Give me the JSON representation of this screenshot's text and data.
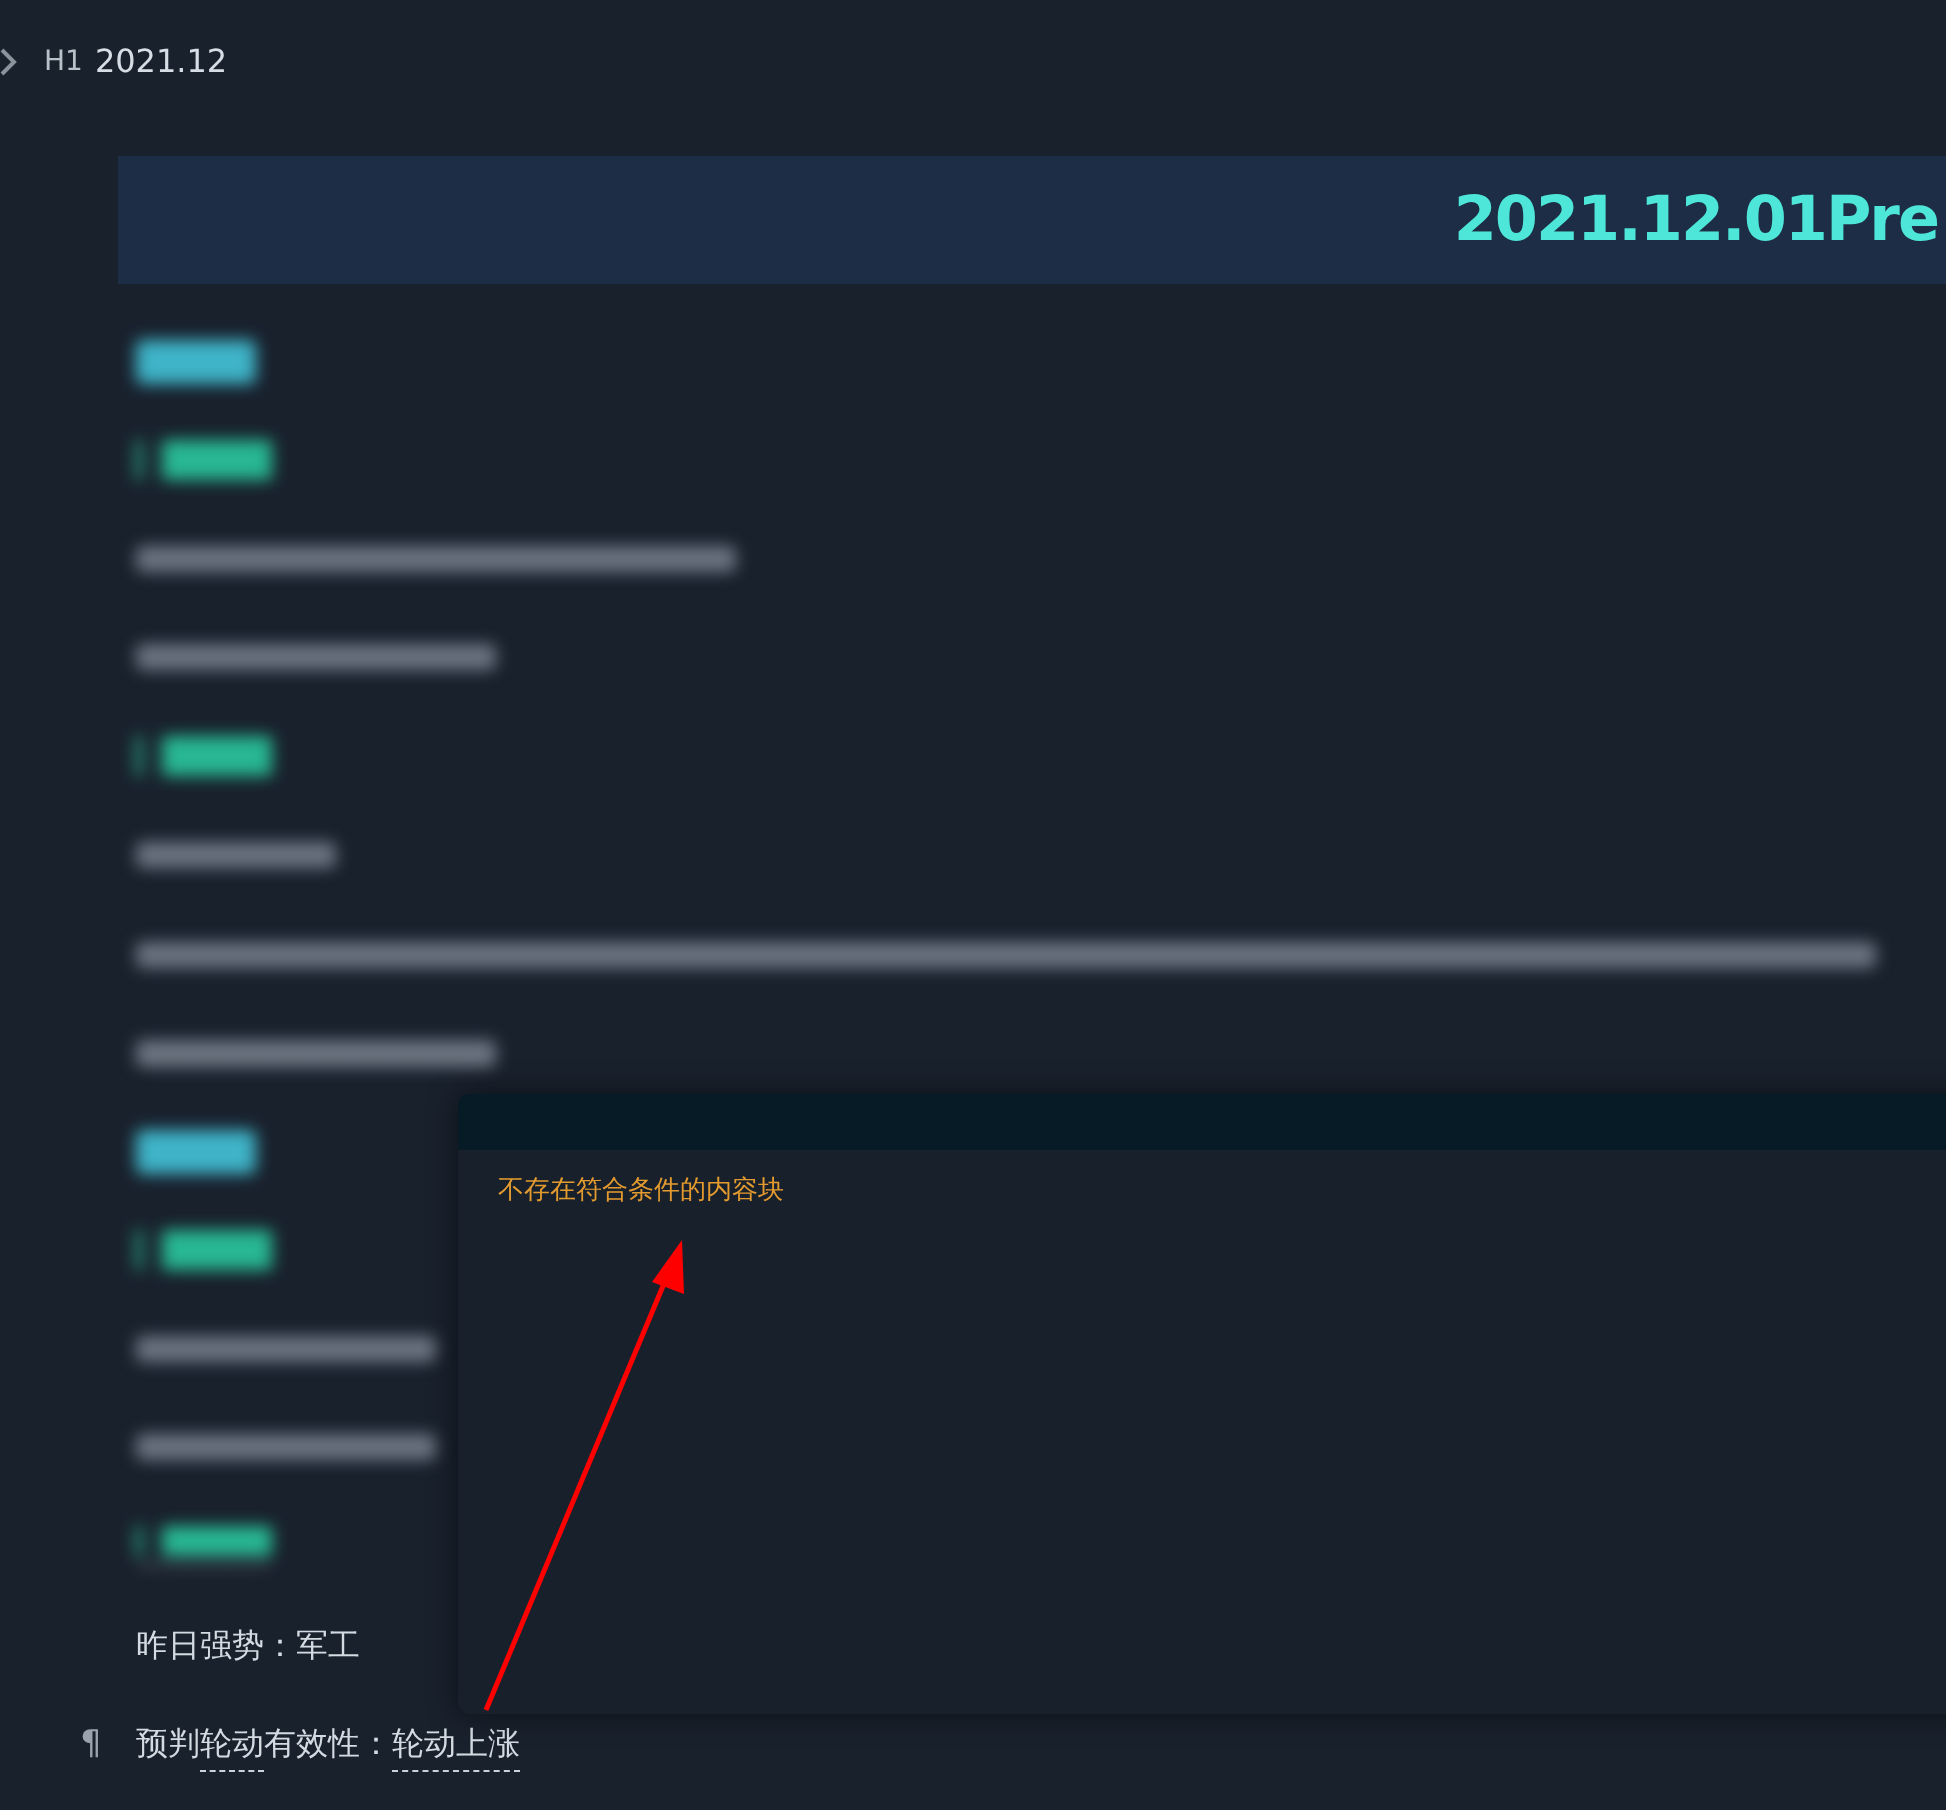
{
  "heading": {
    "marker": "H1",
    "title": "2021.12"
  },
  "banner": {
    "title": "2021.12.01Pre"
  },
  "blocks": [
    {
      "kind": "h2"
    },
    {
      "kind": "h3"
    },
    {
      "kind": "para"
    },
    {
      "kind": "para"
    },
    {
      "kind": "h3"
    },
    {
      "kind": "para"
    },
    {
      "kind": "para"
    },
    {
      "kind": "para-ref"
    },
    {
      "kind": "h2"
    },
    {
      "kind": "h3"
    },
    {
      "kind": "para-short"
    },
    {
      "kind": "para-short"
    },
    {
      "kind": "h3-ref"
    },
    {
      "kind": "text",
      "segments": [
        {
          "text": "昨日强势：军工",
          "ref": false
        }
      ]
    },
    {
      "kind": "text",
      "pilcrow": "¶",
      "segments": [
        {
          "text": "预判",
          "ref": false
        },
        {
          "text": "轮动",
          "ref": true
        },
        {
          "text": "有效性：",
          "ref": false
        },
        {
          "text": "轮动上涨",
          "ref": true
        }
      ]
    }
  ],
  "popup": {
    "message": "不存在符合条件的内容块"
  }
}
